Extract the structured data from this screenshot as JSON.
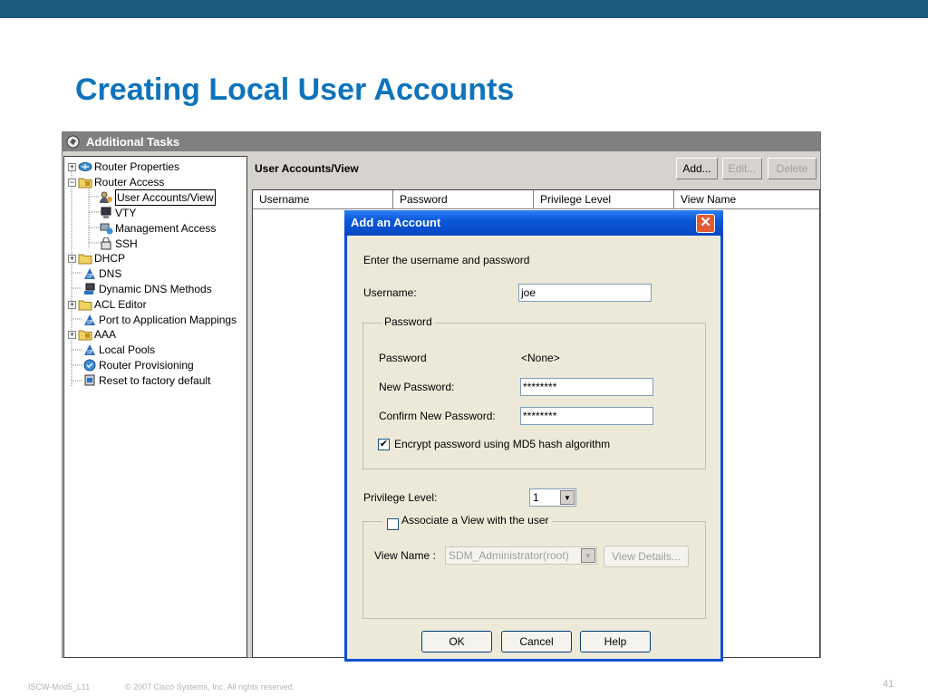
{
  "slide": {
    "title": "Creating Local User Accounts",
    "footer_left": "ISCW-Mod5_L11",
    "footer_copyright": "© 2007 Cisco Systems, Inc. All rights reserved.",
    "page_number": "41"
  },
  "app": {
    "window_title": "Additional Tasks",
    "tree": [
      {
        "label": "Router Properties",
        "expander": "+"
      },
      {
        "label": "Router Access",
        "expander": "-"
      },
      {
        "label": "User Accounts/View",
        "selected": true
      },
      {
        "label": "VTY"
      },
      {
        "label": "Management Access"
      },
      {
        "label": "SSH"
      },
      {
        "label": "DHCP",
        "expander": "+"
      },
      {
        "label": "DNS"
      },
      {
        "label": "Dynamic DNS Methods"
      },
      {
        "label": "ACL Editor",
        "expander": "+"
      },
      {
        "label": "Port to Application Mappings"
      },
      {
        "label": "AAA",
        "expander": "+"
      },
      {
        "label": "Local Pools"
      },
      {
        "label": "Router Provisioning"
      },
      {
        "label": "Reset to factory default"
      }
    ],
    "panel_title": "User Accounts/View",
    "toolbar": {
      "add": "Add...",
      "edit": "Edit...",
      "delete": "Delete"
    },
    "columns": [
      "Username",
      "Password",
      "Privilege Level",
      "View Name"
    ]
  },
  "dialog": {
    "title": "Add an Account",
    "instruction": "Enter the username and password",
    "username_label": "Username:",
    "username_value": "joe",
    "password_group": "Password",
    "password_label": "Password",
    "password_value": "<None>",
    "new_password_label": "New Password:",
    "new_password_value": "********",
    "confirm_label": "Confirm New Password:",
    "confirm_value": "********",
    "encrypt_label": "Encrypt password using MD5 hash algorithm",
    "encrypt_checked": true,
    "privilege_label": "Privilege Level:",
    "privilege_value": "1",
    "associate_label": "Associate a View with the user",
    "associate_checked": false,
    "view_name_label": "View Name :",
    "view_name_value": "SDM_Administrator(root)",
    "view_details_button": "View Details...",
    "ok_button": "OK",
    "cancel_button": "Cancel",
    "help_button": "Help"
  }
}
